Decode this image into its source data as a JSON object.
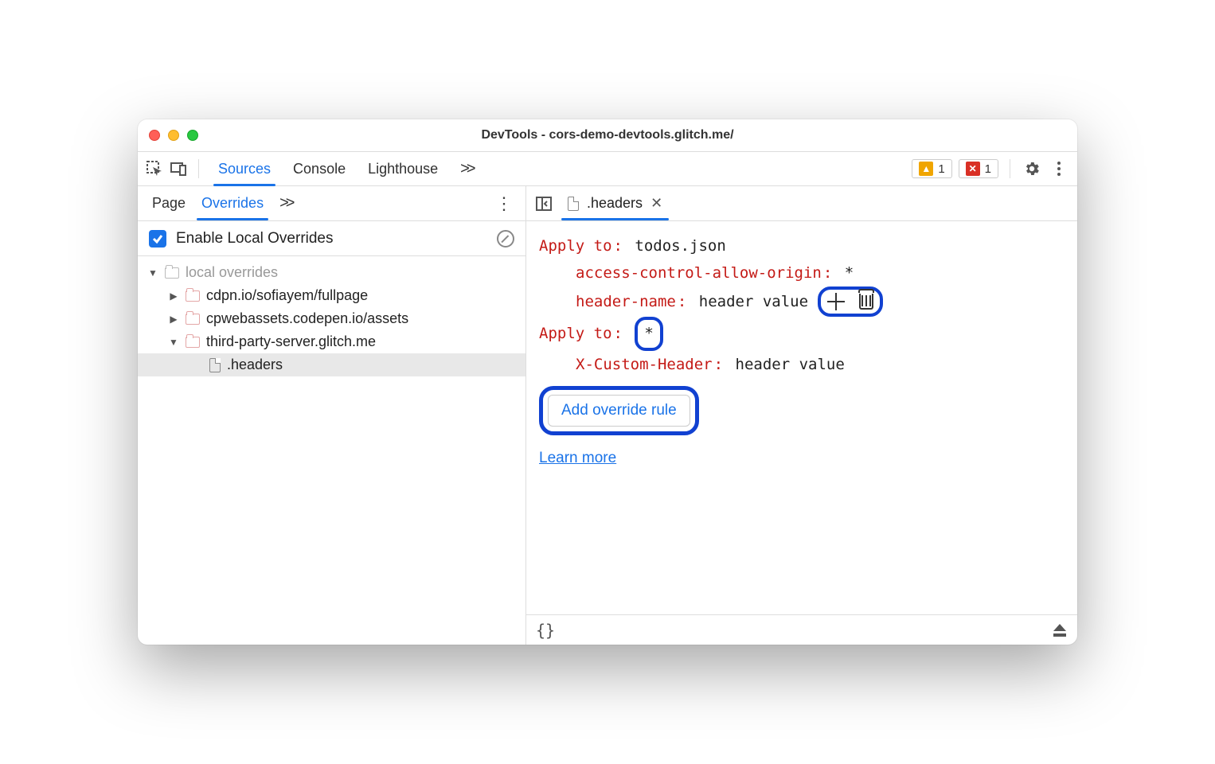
{
  "window": {
    "title": "DevTools - cors-demo-devtools.glitch.me/"
  },
  "toolbar": {
    "tabs": [
      "Sources",
      "Console",
      "Lighthouse"
    ],
    "more": ">>",
    "warnings": "1",
    "errors": "1"
  },
  "left_panel": {
    "tabs": [
      "Page",
      "Overrides"
    ],
    "more": ">>",
    "enable_label": "Enable Local Overrides",
    "tree": {
      "root": "local overrides",
      "folders": [
        "cdpn.io/sofiayem/fullpage",
        "cpwebassets.codepen.io/assets",
        "third-party-server.glitch.me"
      ],
      "file": ".headers"
    }
  },
  "editor_tab": {
    "name": ".headers"
  },
  "editor": {
    "rules": [
      {
        "apply_label": "Apply to",
        "apply_value": "todos.json",
        "headers": [
          {
            "name": "access-control-allow-origin",
            "value": "*"
          },
          {
            "name": "header-name",
            "value": "header value"
          }
        ]
      },
      {
        "apply_label": "Apply to",
        "apply_value": "*",
        "headers": [
          {
            "name": "X-Custom-Header",
            "value": "header value"
          }
        ]
      }
    ],
    "add_button": "Add override rule",
    "learn_more": "Learn more"
  },
  "footer": {
    "format": "{}"
  }
}
